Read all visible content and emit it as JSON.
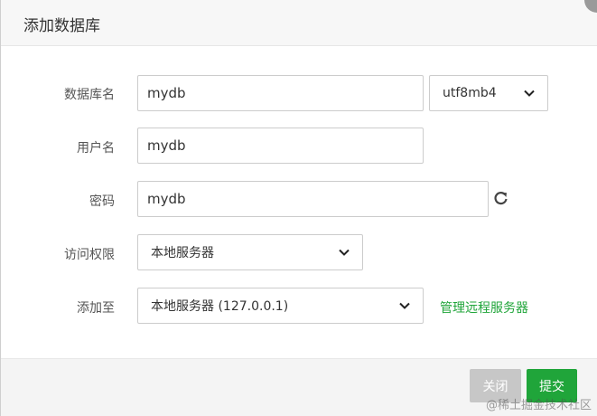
{
  "dialog": {
    "title": "添加数据库"
  },
  "form": {
    "db_name_label": "数据库名",
    "db_name_value": "mydb",
    "charset_value": "utf8mb4",
    "user_label": "用户名",
    "user_value": "mydb",
    "password_label": "密码",
    "password_value": "mydb",
    "access_label": "访问权限",
    "access_value": "本地服务器",
    "add_to_label": "添加至",
    "add_to_value": "本地服务器 (127.0.0.1)",
    "manage_remote_link": "管理远程服务器"
  },
  "footer": {
    "close_label": "关闭",
    "submit_label": "提交"
  },
  "watermark": {
    "text": "@稀土掘金技术社区"
  },
  "colors": {
    "accent_green": "#20a53a",
    "disabled_gray": "#c7c7c7"
  },
  "icons": [
    "refresh-icon",
    "chevron-down-icon"
  ]
}
